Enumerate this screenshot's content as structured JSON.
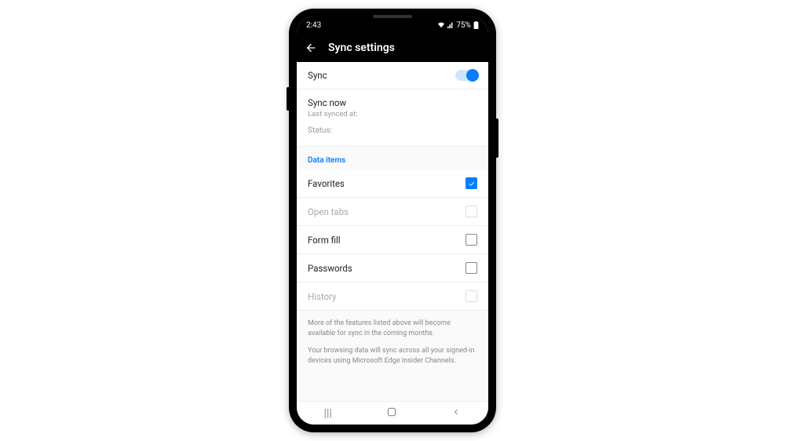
{
  "statusbar": {
    "time": "2:43",
    "battery": "75%"
  },
  "appbar": {
    "title": "Sync settings"
  },
  "sync": {
    "label": "Sync",
    "on": true
  },
  "sync_now": {
    "label": "Sync now",
    "sub": "Last synced at:"
  },
  "status": {
    "label": "Status:"
  },
  "data_items": {
    "title": "Data items",
    "items": [
      {
        "label": "Favorites",
        "checked": true,
        "disabled": false
      },
      {
        "label": "Open tabs",
        "checked": false,
        "disabled": true
      },
      {
        "label": "Form fill",
        "checked": false,
        "disabled": false
      },
      {
        "label": "Passwords",
        "checked": false,
        "disabled": false
      },
      {
        "label": "History",
        "checked": false,
        "disabled": true
      }
    ]
  },
  "notes": {
    "line1": "More of the features listed above will become available for sync in the coming months.",
    "line2": "Your browsing data will sync across all your signed-in devices using Microsoft Edge Insider Channels."
  }
}
